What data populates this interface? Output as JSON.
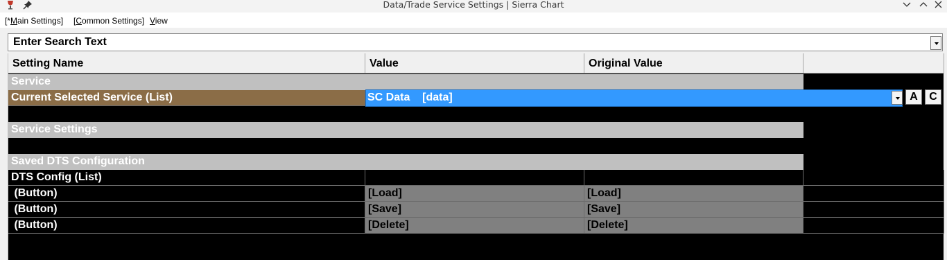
{
  "window": {
    "title": "Data/Trade Service Settings | Sierra Chart"
  },
  "menu": {
    "main_settings": {
      "prefix": "[*",
      "accel": "M",
      "rest": "ain Settings]"
    },
    "common_settings": {
      "prefix": "[",
      "accel": "C",
      "rest": "ommon Settings]"
    },
    "view": {
      "accel": "V",
      "rest": "iew"
    }
  },
  "search": {
    "text": "Enter Search Text"
  },
  "columns": [
    "Setting Name",
    "Value",
    "Original Value"
  ],
  "sections": {
    "service": "Service",
    "service_settings": "Service Settings",
    "saved_dts": "Saved DTS Configuration"
  },
  "rows": {
    "current_service": {
      "name": "Current Selected Service (List)",
      "value": "SC Data    [data]",
      "btn_a": "A",
      "btn_c": "C"
    },
    "dts_config": {
      "name": "DTS Config (List)"
    },
    "load": {
      "name": " (Button)",
      "value": "[Load]",
      "original": "[Load]"
    },
    "save": {
      "name": " (Button)",
      "value": "[Save]",
      "original": "[Save]"
    },
    "delete": {
      "name": " (Button)",
      "value": "[Delete]",
      "original": "[Delete]"
    }
  },
  "colors": {
    "selected_row_name": "#8b6d47",
    "selected_value": "#3399ff",
    "section_band": "#c0c0c0",
    "grid_background": "#000000",
    "button_cell": "#808080"
  },
  "icons": [
    "sierra-chart-app-icon",
    "pin-icon",
    "chevron-down-icon",
    "chevron-up-icon",
    "close-icon",
    "dropdown-arrow-icon"
  ]
}
